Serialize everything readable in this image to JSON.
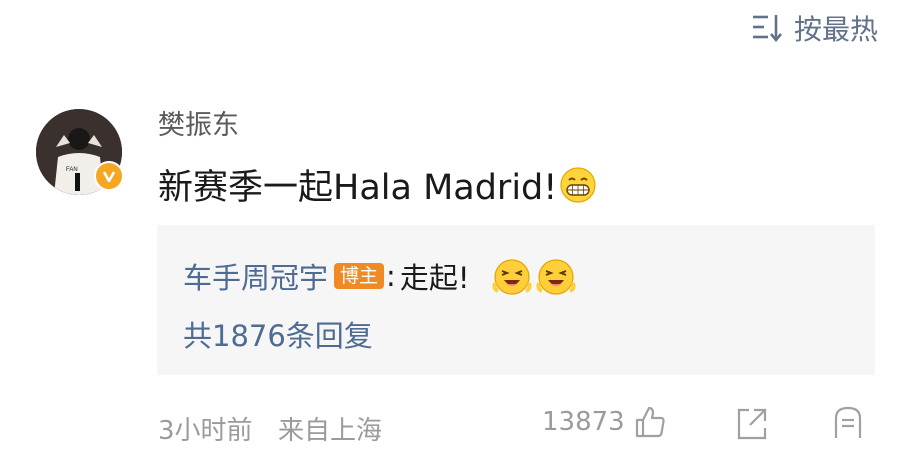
{
  "sort": {
    "label": "按最热",
    "icon": "sort-icon"
  },
  "comment": {
    "username": "樊振东",
    "text": "新赛季一起Hala Madrid!",
    "emoji": "grin-emoji",
    "verified_badge": "V",
    "reply_preview": {
      "author": "车手周冠宇",
      "badge": "博主",
      "separator": ":",
      "text": "走起!",
      "emojis": [
        "laughing-emoji",
        "laughing-emoji"
      ],
      "count_text": "共1876条回复"
    },
    "meta": {
      "time": "3小时前",
      "source": "来自上海",
      "like_count": "13873"
    }
  },
  "colors": {
    "link_blue": "#4e6b94",
    "badge_orange": "#f08a24",
    "meta_gray": "#9b9b9b",
    "reply_bg": "#f6f6f6"
  }
}
